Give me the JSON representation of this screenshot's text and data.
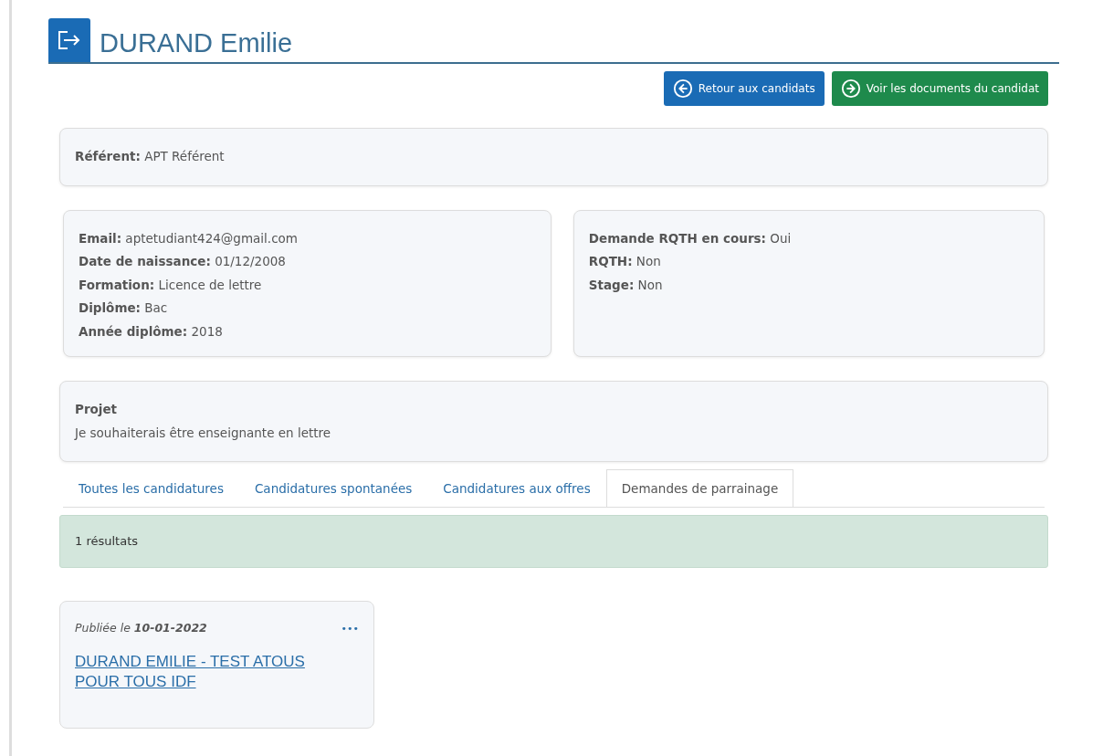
{
  "header": {
    "title": "DURAND Emilie"
  },
  "actions": [
    {
      "kind": "back",
      "label": "Retour aux candidats"
    },
    {
      "kind": "forward",
      "label": "Voir les documents du candidat"
    }
  ],
  "referent": "**Référent:** APT Référent",
  "info_left": [
    "**Email:** aptetudiant424@gmail.com",
    "**Date de naissance:** 01/12/2008",
    "**Formation:** Licence de lettre",
    "**Diplôme:** Bac",
    "**Année diplôme:** 2018"
  ],
  "info_right": [
    "**Demande RQTH en cours:** Oui",
    "**RQTH:** Non",
    "**Stage:** Non"
  ],
  "project": {
    "heading": "Projet",
    "text": "Je souhaiterais être enseignante en lettre"
  },
  "tabs": [
    {
      "label": "Toutes les candidatures",
      "selected": false
    },
    {
      "label": "Candidatures spontanées",
      "selected": false
    },
    {
      "label": "Candidatures aux offres",
      "selected": false
    },
    {
      "label": "Demandes de parrainage",
      "selected": true
    }
  ],
  "results": "1 résultats",
  "cards": [
    {
      "published": "Publiée le **10-01-2022**",
      "menu": "•••",
      "title": "DURAND EMILIE - TEST ATOUS POUR TOUS IDF"
    }
  ]
}
